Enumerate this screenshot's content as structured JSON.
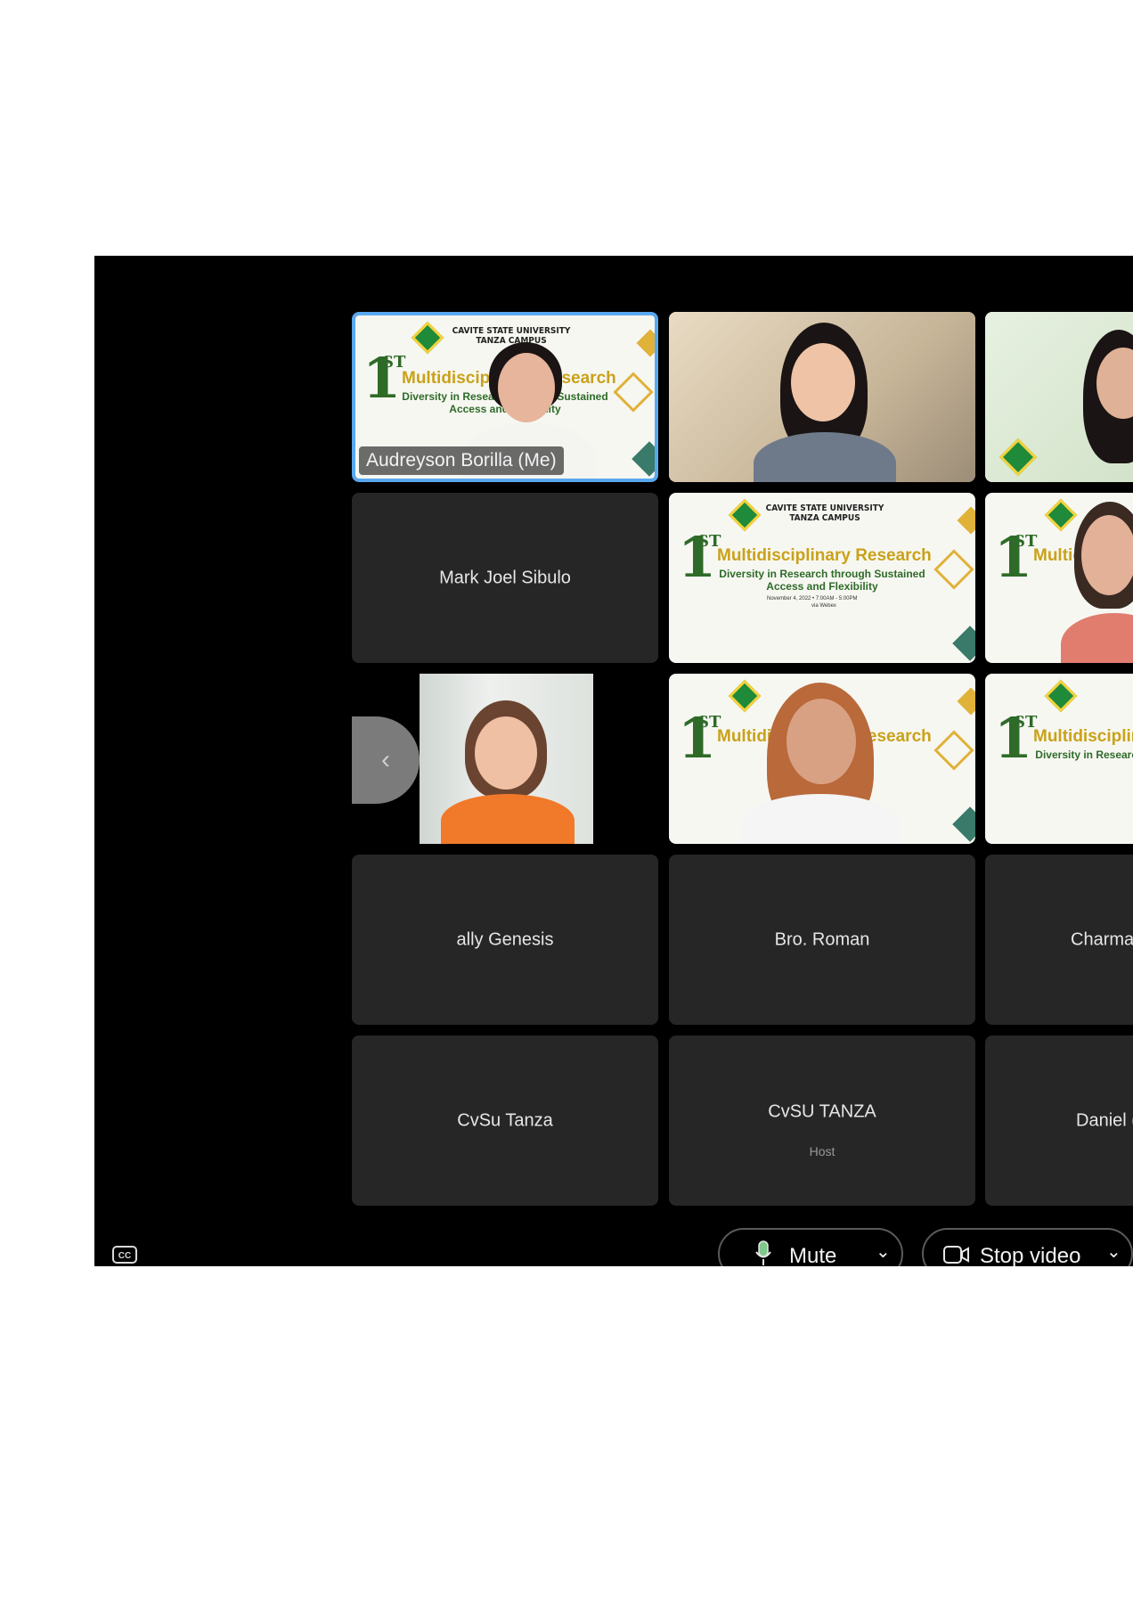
{
  "participants": {
    "self_name": "Audreyson Borilla (Me)",
    "mark": "Mark Joel Sibulo",
    "ally": "ally Genesis",
    "roman": "Bro. Roman",
    "charmai": "Charmai",
    "cvsu_tanza": "CvSu Tanza",
    "cvsu_host": "CvSU TANZA",
    "host_label": "Host",
    "daniel": "Daniel ("
  },
  "banner": {
    "university": "CAVITE STATE UNIVERSITY",
    "campus": "TANZA CAMPUS",
    "one": "1",
    "st": "ST",
    "title": "Multidisciplinary Research",
    "subtitle": "Diversity in Research through Sustained",
    "subtitle2": "Access and Flexibility",
    "date": "November 4, 2022 • 7:00AM - 5:00PM",
    "via": "via Webex"
  },
  "controls": {
    "cc_label": "CC",
    "mute_label": "Mute",
    "video_label": "Stop video",
    "prev_arrow": "‹",
    "chevron": "⌄"
  },
  "colors": {
    "background": "#000000",
    "tile": "#262626",
    "self_border": "#59a8ef"
  }
}
